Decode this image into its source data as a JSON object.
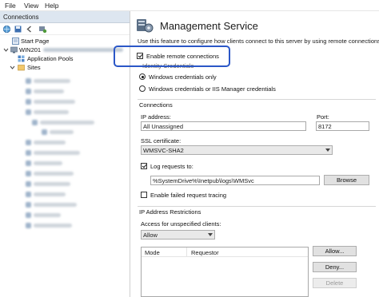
{
  "menu": {
    "file": "File",
    "view": "View",
    "help": "Help"
  },
  "left_pane": {
    "header": "Connections",
    "tree": {
      "start_page": "Start Page",
      "server": "WIN201",
      "app_pools": "Application Pools",
      "sites": "Sites"
    }
  },
  "main": {
    "title": "Management Service",
    "description": "Use this feature to configure how clients connect to this server by using remote connections in IIS I",
    "enable_remote": "Enable remote connections",
    "identity": {
      "header": "Identity Credentials",
      "windows_only": "Windows credentials only",
      "windows_or_iis": "Windows credentials or IIS Manager credentials"
    },
    "connections": {
      "header": "Connections",
      "ip_label": "IP address:",
      "ip_value": "All Unassigned",
      "port_label": "Port:",
      "port_value": "8172",
      "ssl_label": "SSL certificate:",
      "ssl_value": "WMSVC-SHA2",
      "log_label": "Log requests to:",
      "log_path": "%SystemDrive%\\Inetpub\\logs\\WMSvc",
      "browse": "Browse",
      "failed_tracing": "Enable failed request tracing"
    },
    "ip_restrictions": {
      "header": "IP Address Restrictions",
      "access_label": "Access for unspecified clients:",
      "access_value": "Allow",
      "col_mode": "Mode",
      "col_requestor": "Requestor",
      "allow_btn": "Allow...",
      "deny_btn": "Deny...",
      "delete_btn": "Delete"
    }
  },
  "colors": {
    "highlight": "#2b57c7",
    "pane_header": "#dde6f0",
    "service_icon": "#5b6f86"
  },
  "icons": [
    "globe-icon",
    "save-icon",
    "back-icon",
    "connect-icon",
    "start-page-icon",
    "server-icon",
    "app-pools-icon",
    "sites-icon",
    "management-service-icon"
  ]
}
